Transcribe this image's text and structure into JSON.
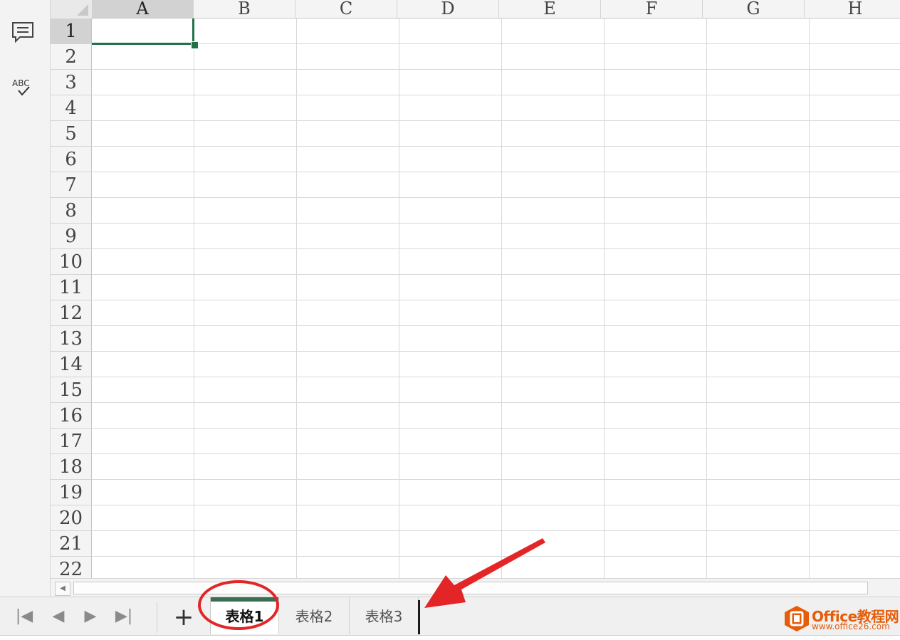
{
  "sidebar": {
    "icons": [
      "comment-icon",
      "spell-check-icon"
    ],
    "spell_label": "ABC"
  },
  "grid": {
    "columns": [
      "A",
      "B",
      "C",
      "D",
      "E",
      "F",
      "G",
      "H"
    ],
    "rows": [
      "1",
      "2",
      "3",
      "4",
      "5",
      "6",
      "7",
      "8",
      "9",
      "10",
      "11",
      "12",
      "13",
      "14",
      "15",
      "16",
      "17",
      "18",
      "19",
      "20",
      "21",
      "22"
    ],
    "selected_cell": "A1",
    "accent_color": "#217346"
  },
  "sheet_tabs": {
    "add_label": "+",
    "tabs": [
      {
        "label": "表格1",
        "active": true
      },
      {
        "label": "表格2",
        "active": false
      },
      {
        "label": "表格3",
        "active": false
      }
    ]
  },
  "annotation": {
    "ellipse_color": "#e42528",
    "arrow_color": "#e42528"
  },
  "watermark": {
    "title": "Office教程网",
    "url": "www.office26.com",
    "color": "#e65c0a"
  }
}
